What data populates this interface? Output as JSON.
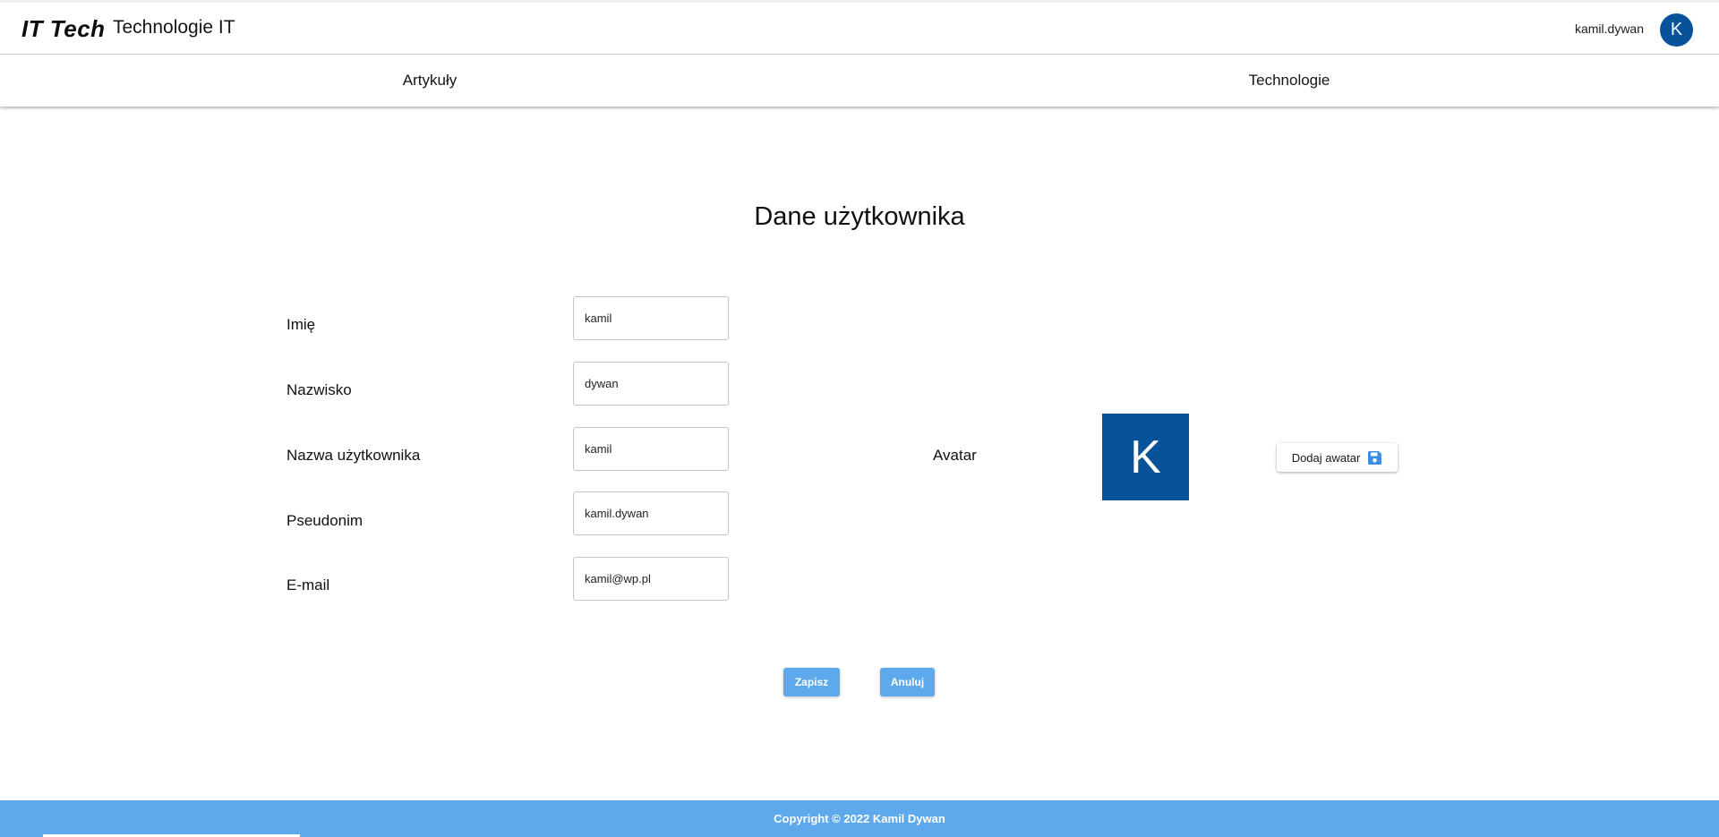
{
  "header": {
    "logo": "IT Tech",
    "title": "Technologie IT",
    "username": "kamil.dywan",
    "avatar_letter": "K"
  },
  "nav": {
    "items": [
      {
        "label": "Artykuły"
      },
      {
        "label": "Technologie"
      }
    ]
  },
  "form": {
    "title": "Dane użytkownika",
    "fields": [
      {
        "label": "Imię",
        "value": "kamil"
      },
      {
        "label": "Nazwisko",
        "value": "dywan"
      },
      {
        "label": "Nazwa użytkownika",
        "value": "kamil"
      },
      {
        "label": "Pseudonim",
        "value": "kamil.dywan"
      },
      {
        "label": "E-mail",
        "value": "kamil@wp.pl"
      }
    ],
    "avatar_label": "Avatar",
    "avatar_letter": "K",
    "add_avatar_label": "Dodaj awatar",
    "save_label": "Zapisz",
    "cancel_label": "Anuluj"
  },
  "footer": {
    "copyright": "Copyright © 2022 Kamil Dywan"
  },
  "colors": {
    "brand_blue": "#08529a",
    "accent_blue": "#5ea9ec",
    "icon_blue": "#3b8ee0"
  },
  "icons": {
    "add_avatar": "floppy-disk-save-icon"
  }
}
